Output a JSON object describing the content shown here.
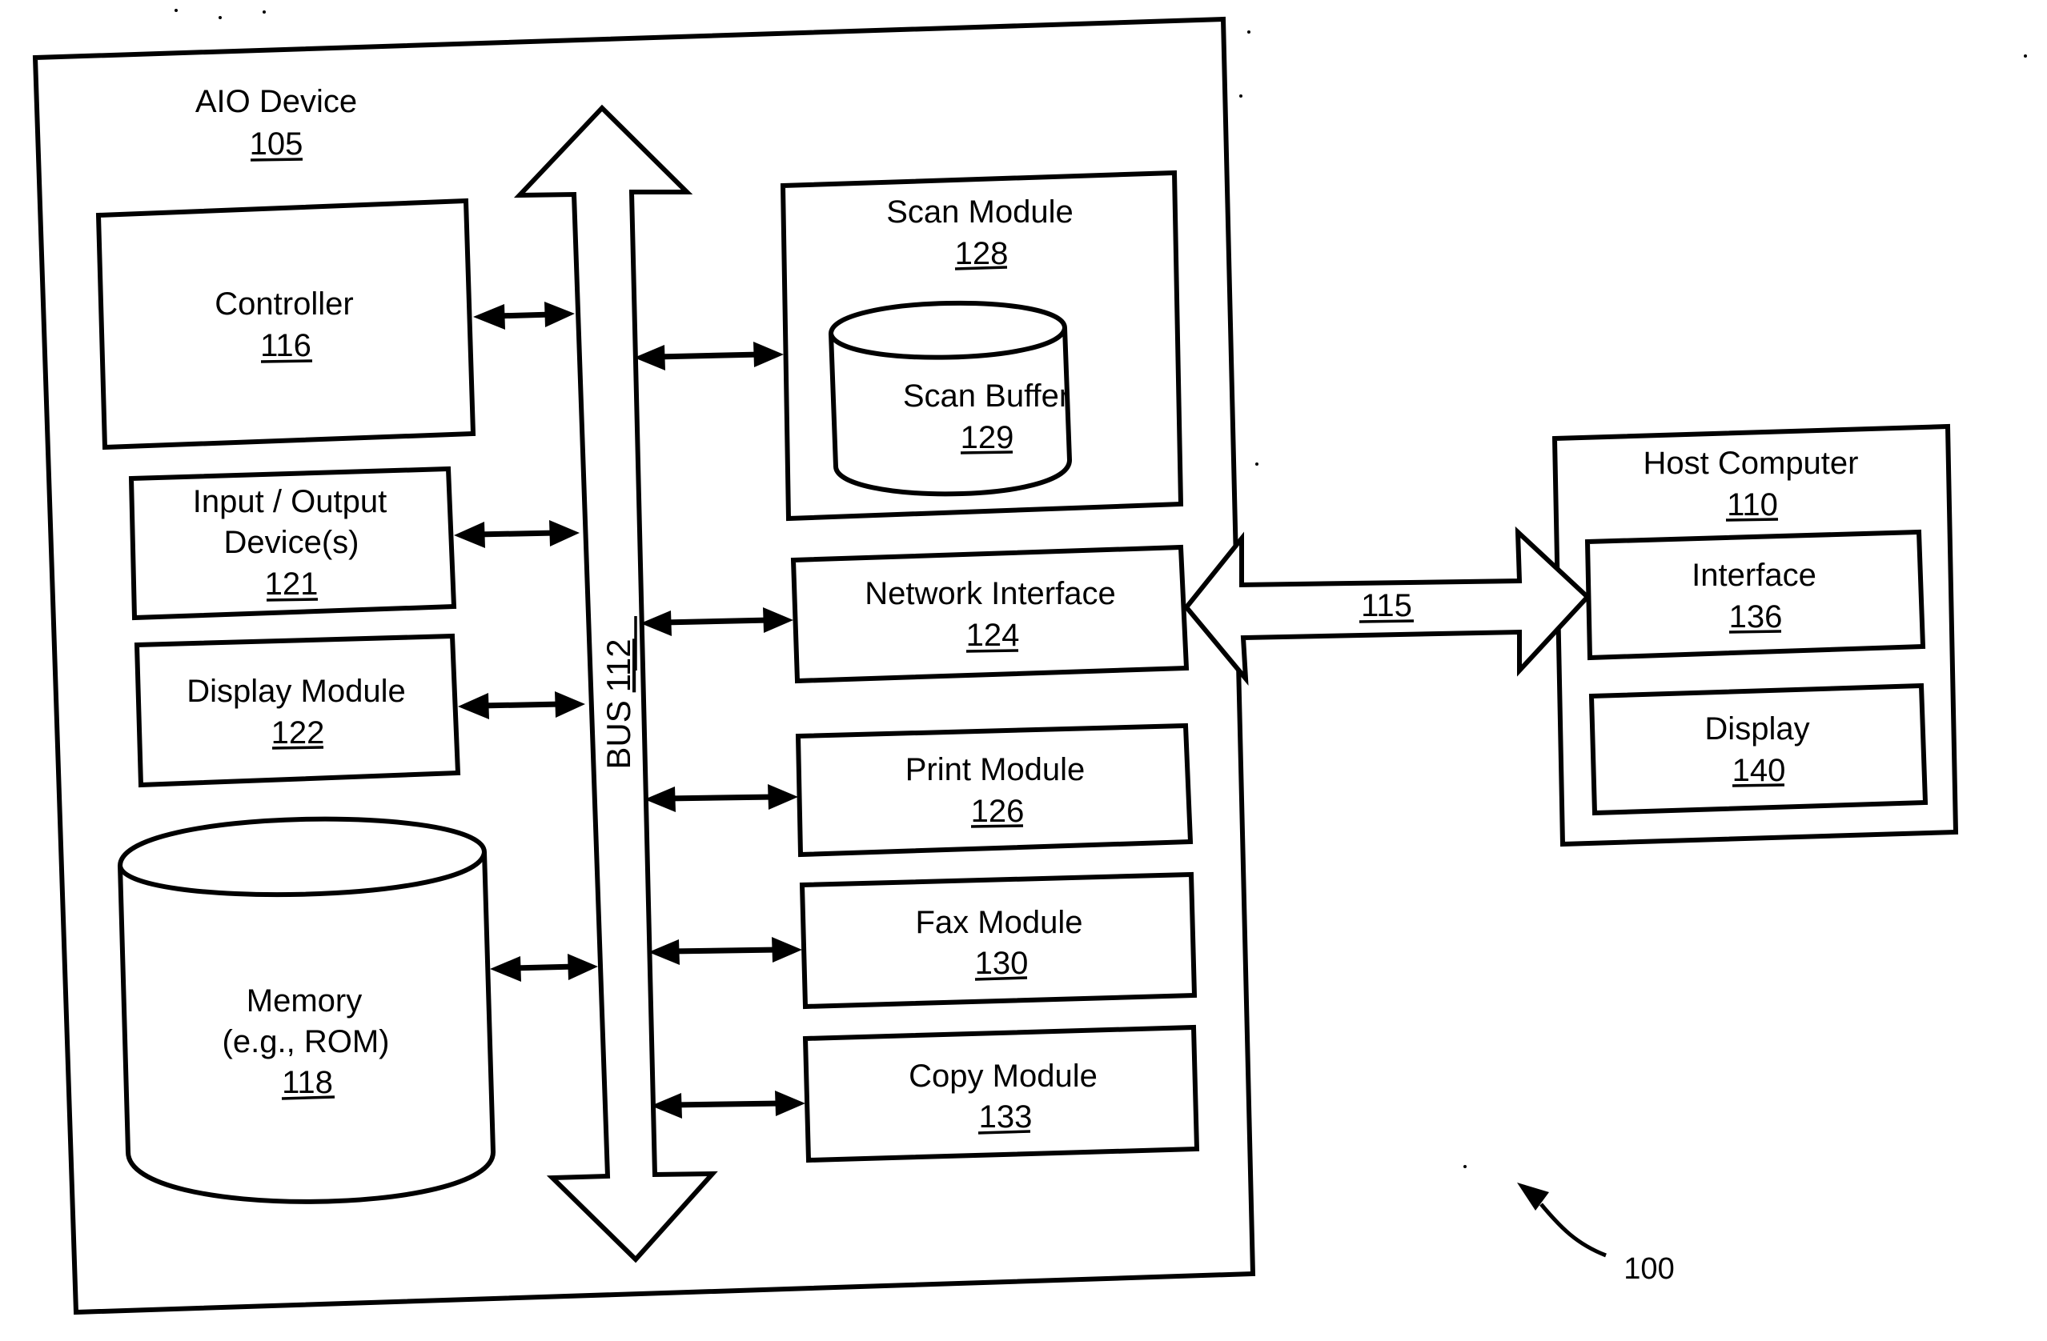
{
  "figure": {
    "reference_number": "100",
    "aio_device": {
      "title": "AIO Device",
      "number": "105",
      "bus": {
        "label": "BUS",
        "number": "112"
      },
      "left_components": [
        {
          "id": "controller",
          "lines": [
            "Controller"
          ],
          "number": "116",
          "shape": "box"
        },
        {
          "id": "io",
          "lines": [
            "Input / Output",
            "Device(s)"
          ],
          "number": "121",
          "shape": "box"
        },
        {
          "id": "display-module",
          "lines": [
            "Display Module"
          ],
          "number": "122",
          "shape": "box"
        },
        {
          "id": "memory",
          "lines": [
            "Memory",
            "(e.g., ROM)"
          ],
          "number": "118",
          "shape": "cylinder"
        }
      ],
      "right_components": [
        {
          "id": "scan-module",
          "lines": [
            "Scan Module"
          ],
          "number": "128",
          "shape": "box",
          "child": {
            "id": "scan-buffer",
            "lines": [
              "Scan Buffer"
            ],
            "number": "129",
            "shape": "cylinder"
          }
        },
        {
          "id": "network-interface",
          "lines": [
            "Network Interface"
          ],
          "number": "124",
          "shape": "box"
        },
        {
          "id": "print-module",
          "lines": [
            "Print Module"
          ],
          "number": "126",
          "shape": "box"
        },
        {
          "id": "fax-module",
          "lines": [
            "Fax Module"
          ],
          "number": "130",
          "shape": "box"
        },
        {
          "id": "copy-module",
          "lines": [
            "Copy Module"
          ],
          "number": "133",
          "shape": "box"
        }
      ]
    },
    "link": {
      "number": "115",
      "from": "network-interface",
      "to": "interface"
    },
    "host_computer": {
      "title": "Host Computer",
      "number": "110",
      "components": [
        {
          "id": "interface",
          "lines": [
            "Interface"
          ],
          "number": "136"
        },
        {
          "id": "display",
          "lines": [
            "Display"
          ],
          "number": "140"
        }
      ]
    }
  }
}
